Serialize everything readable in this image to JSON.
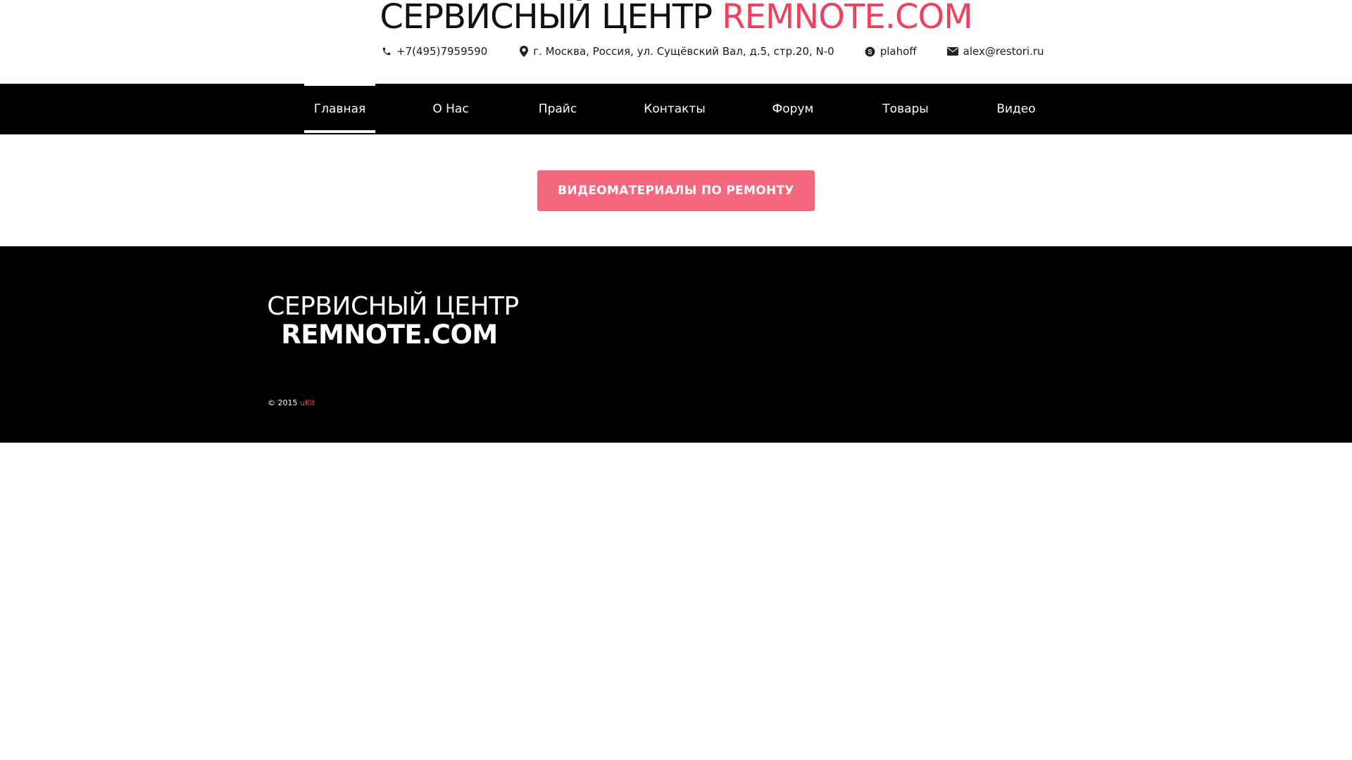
{
  "header": {
    "title_main": "СЕРВИСНЫЙ ЦЕНТР",
    "title_accent": "REMNOTE.COM",
    "contacts": {
      "phone": "+7(495)7959590",
      "address": "г. Москва, Россия, ул. Сущёвский Вал, д.5, стр.20, N-0",
      "skype": "plahoff",
      "email": "alex@restori.ru"
    },
    "icons": [
      "phone-icon",
      "map-pin-icon",
      "skype-icon",
      "envelope-icon"
    ]
  },
  "nav": {
    "active": "Главная",
    "items": [
      "Главная",
      "О Нас",
      "Прайс",
      "Контакты",
      "Форум",
      "Товары",
      "Видео"
    ]
  },
  "cta": {
    "label": "ВИДЕОМАТЕРИАЛЫ ПО РЕМОНТУ"
  },
  "footer": {
    "logo_line1": "СЕРВИСНЫЙ ЦЕНТР",
    "logo_line2": "REMNOTE.COM",
    "copyright_prefix": "© 2015",
    "copyright_link": "uKit"
  },
  "colors": {
    "accent": "#f0405f",
    "button": "#f4677c",
    "nav_bg": "#000000",
    "footer_bg": "#000000"
  }
}
